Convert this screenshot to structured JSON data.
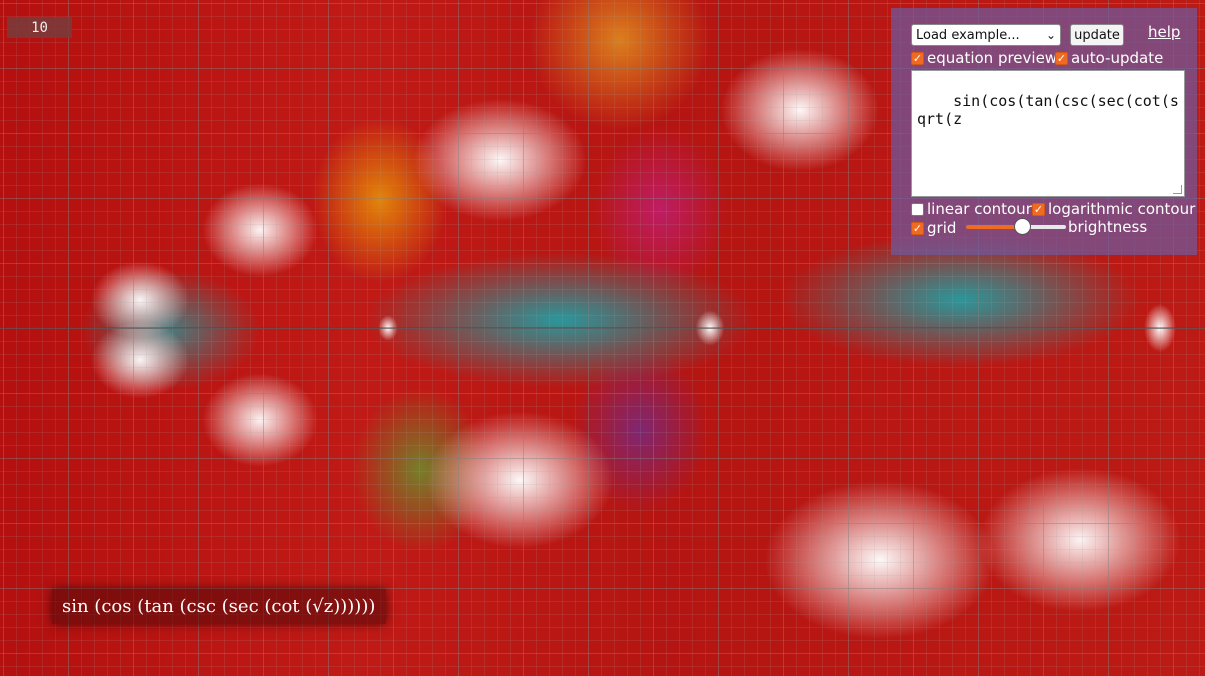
{
  "view": {
    "zoom_level": "10",
    "accent_color": "#f06a22"
  },
  "panel": {
    "example_select": {
      "value": "Load example..."
    },
    "update_label": "update",
    "help_label": "help",
    "equation_preview": {
      "label": "equation preview",
      "checked": true
    },
    "auto_update": {
      "label": "auto-update",
      "checked": true
    },
    "equation_text": "sin(cos(tan(csc(sec(cot(sqrt(z",
    "linear_contour": {
      "label": "linear contour",
      "checked": false
    },
    "logarithmic_contour": {
      "label": "logarithmic contour",
      "checked": true
    },
    "grid": {
      "label": "grid",
      "checked": true
    },
    "brightness": {
      "label": "brightness",
      "value": 0.56
    }
  },
  "formula": {
    "rendered": "sin (cos (tan (csc (sec (cot (√z))))))"
  }
}
